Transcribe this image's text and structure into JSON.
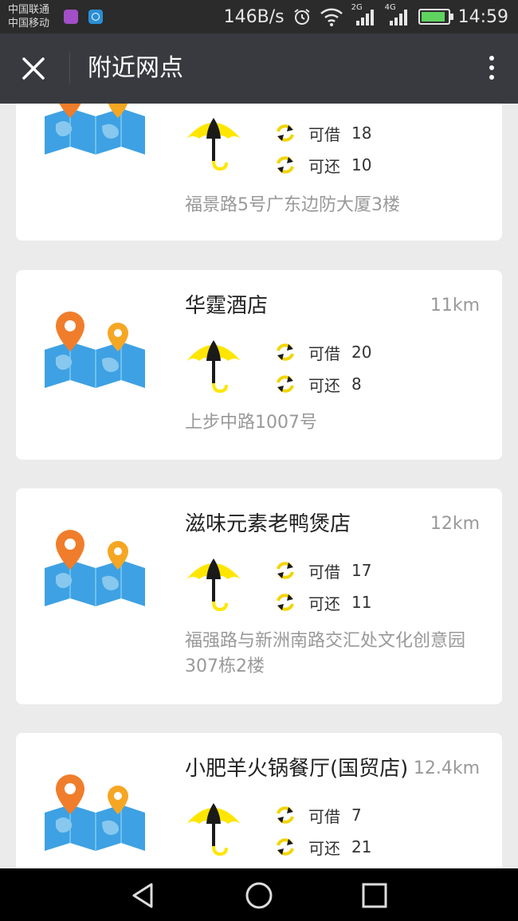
{
  "status_bar": {
    "carrier_1": "中国联通",
    "carrier_2": "中国移动",
    "net_speed": "146B/s",
    "signal_1_type": "2G",
    "signal_2_type": "4G",
    "time": "14:59"
  },
  "header": {
    "title": "附近网点",
    "close_icon": "close-icon",
    "more_icon": "more-vertical-icon"
  },
  "labels": {
    "borrow": "可借",
    "return": "可还"
  },
  "colors": {
    "appbar": "#393a3f",
    "statusbar": "#2b2b2b",
    "umbrella_yellow": "#ffe600",
    "pin_orange": "#f07d2b"
  },
  "cards": [
    {
      "name": "",
      "distance": "",
      "borrow": "18",
      "return": "10",
      "address": "福景路5号广东边防大厦3楼"
    },
    {
      "name": "华霆酒店",
      "distance": "11km",
      "borrow": "20",
      "return": "8",
      "address": "上步中路1007号"
    },
    {
      "name": "滋味元素老鸭煲店",
      "distance": "12km",
      "borrow": "17",
      "return": "11",
      "address": "福强路与新洲南路交汇处文化创意园307栋2楼"
    },
    {
      "name": "小肥羊火锅餐厅(国贸店)",
      "distance": "12.4km",
      "borrow": "7",
      "return": "21",
      "address": ""
    }
  ],
  "nav": {
    "back_icon": "back-triangle-icon",
    "home_icon": "home-circle-icon",
    "recents_icon": "recents-square-icon"
  }
}
